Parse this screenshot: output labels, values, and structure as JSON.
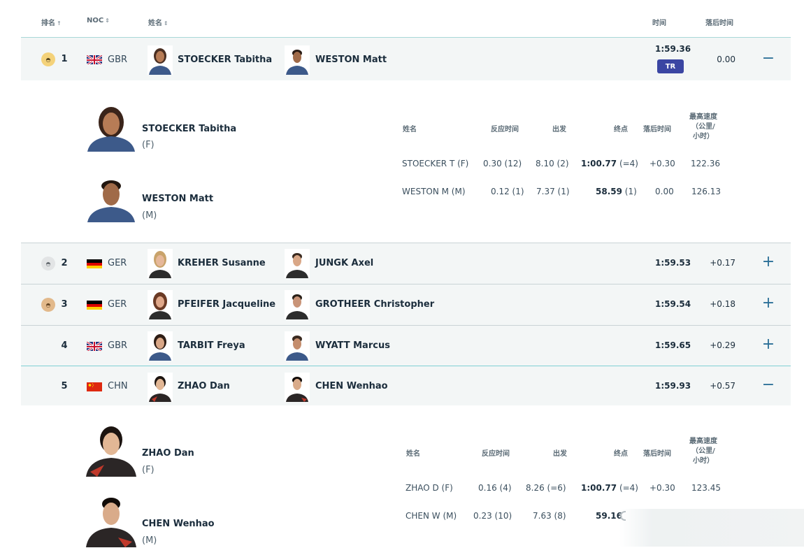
{
  "header": {
    "rank": "排名",
    "noc": "NOC",
    "name": "姓名",
    "time": "时间",
    "behind": "落后时间"
  },
  "rows": [
    {
      "rank": "1",
      "medal": "gold",
      "noc": "GBR",
      "athlete1": "STOECKER Tabitha",
      "athlete2": "WESTON Matt",
      "time": "1:59.36",
      "badge": "TR",
      "behind": "0.00",
      "toggle": "−"
    },
    {
      "rank": "2",
      "medal": "silver",
      "noc": "GER",
      "athlete1": "KREHER Susanne",
      "athlete2": "JUNGK Axel",
      "time": "1:59.53",
      "behind": "+0.17",
      "toggle": "+"
    },
    {
      "rank": "3",
      "medal": "bronze",
      "noc": "GER",
      "athlete1": "PFEIFER Jacqueline",
      "athlete2": "GROTHEER Christopher",
      "time": "1:59.54",
      "behind": "+0.18",
      "toggle": "+"
    },
    {
      "rank": "4",
      "medal": "",
      "noc": "GBR",
      "athlete1": "TARBIT Freya",
      "athlete2": "WYATT Marcus",
      "time": "1:59.65",
      "behind": "+0.29",
      "toggle": "+"
    },
    {
      "rank": "5",
      "medal": "",
      "noc": "CHN",
      "athlete1": "ZHAO Dan",
      "athlete2": "CHEN Wenhao",
      "time": "1:59.93",
      "behind": "+0.57",
      "toggle": "−"
    }
  ],
  "detail_headers": {
    "name": "姓名",
    "reaction": "反应时间",
    "start": "出发",
    "finish": "终点",
    "behind": "落后时间",
    "speed_l1": "最高速度",
    "speed_l2": "（公里/",
    "speed_l3": "小时）"
  },
  "detail1": {
    "athletes": [
      {
        "name": "STOECKER Tabitha",
        "gender": "(F)",
        "short": "STOECKER T (F)",
        "reaction": "0.30 (12)",
        "start": "8.10 (2)",
        "finish": "1:00.77",
        "finish_rank": "(=4)",
        "behind": "+0.30",
        "speed": "122.36"
      },
      {
        "name": "WESTON Matt",
        "gender": "(M)",
        "short": "WESTON M (M)",
        "reaction": "0.12 (1)",
        "start": "7.37 (1)",
        "finish": "58.59",
        "finish_rank": "(1)",
        "behind": "0.00",
        "speed": "126.13"
      }
    ]
  },
  "detail5": {
    "athletes": [
      {
        "name": "ZHAO Dan",
        "gender": "(F)",
        "short": "ZHAO D (F)",
        "reaction": "0.16 (4)",
        "start": "8.26 (=6)",
        "finish": "1:00.77",
        "finish_rank": "(=4)",
        "behind": "+0.30",
        "speed": "123.45"
      },
      {
        "name": "CHEN Wenhao",
        "gender": "(M)",
        "short": "CHEN W (M)",
        "reaction": "0.23 (10)",
        "start": "7.63 (8)",
        "finish": "59.16"
      }
    ]
  },
  "colors": {
    "accent": "#2a6f97",
    "badge": "#3b46a3",
    "band": "#f3f6f6",
    "gold": "#f4d27a",
    "silver": "#e2e4e5",
    "bronze": "#e2b98b"
  },
  "icons": {
    "sort": "sort-arrows-icon",
    "rank_sort": "arrow-up-icon",
    "expand": "plus-icon",
    "collapse": "minus-icon"
  }
}
